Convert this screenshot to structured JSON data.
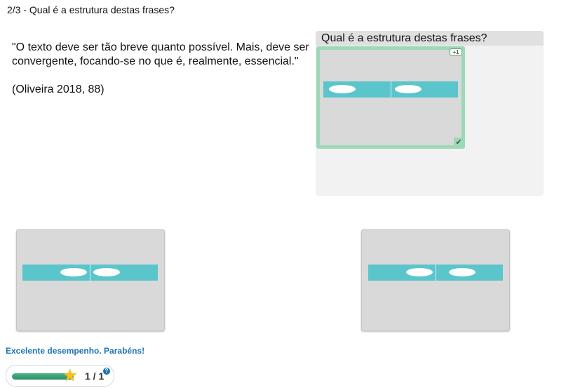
{
  "header": {
    "title": "2/3 - Qual é a estrutura destas frases?"
  },
  "quote": {
    "text": "\"O texto deve ser tão breve quanto possível. Mais, deve ser convergente, focando-se no que é, realmente, essencial.\"",
    "citation": "(Oliveira 2018, 88)"
  },
  "drop_panel": {
    "title": "Qual é a estrutura destas frases?",
    "points_badge": "+1",
    "check_icon": "check-icon"
  },
  "colors": {
    "bar": "#5bc5cc",
    "card": "#d9d9d9",
    "correct_border": "#9fd8b8",
    "feedback": "#1c74b5"
  },
  "feedback": {
    "message": "Excelente desempenho. Parabéns!"
  },
  "score": {
    "text": "1 / 1",
    "progress": 1.0,
    "star_icon": "star-icon",
    "help": "?"
  }
}
